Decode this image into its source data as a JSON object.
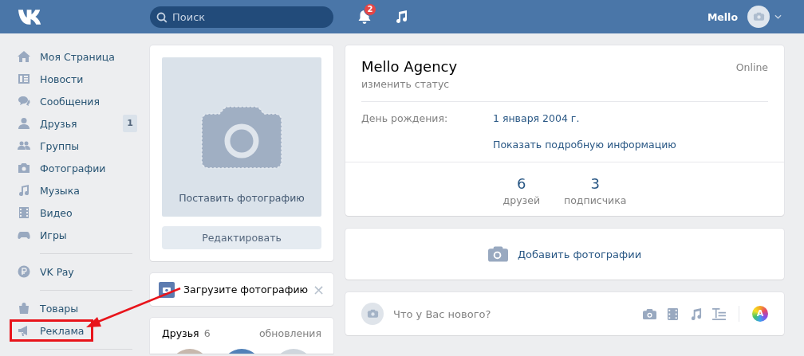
{
  "header": {
    "search": {
      "placeholder": "Поиск"
    },
    "notifications_badge": "2",
    "user_name": "Mello"
  },
  "sidebar": {
    "groups": [
      [
        {
          "label": "Моя Страница",
          "highlighted": false
        },
        {
          "label": "Новости",
          "highlighted": false
        },
        {
          "label": "Сообщения",
          "highlighted": false
        },
        {
          "label": "Друзья",
          "badge": "1",
          "highlighted": false
        },
        {
          "label": "Группы",
          "highlighted": false
        },
        {
          "label": "Фотографии",
          "highlighted": false
        },
        {
          "label": "Музыка",
          "highlighted": false
        },
        {
          "label": "Видео",
          "highlighted": false
        },
        {
          "label": "Игры",
          "highlighted": false
        }
      ],
      [
        {
          "label": "VK Pay",
          "highlighted": false
        }
      ],
      [
        {
          "label": "Товары",
          "highlighted": false
        },
        {
          "label": "Реклама",
          "highlighted": true
        }
      ]
    ]
  },
  "photo_card": {
    "caption": "Поставить фотографию",
    "edit_button": "Редактировать"
  },
  "notice": {
    "text": "Загрузите фотографию",
    "close": "×"
  },
  "friends_card": {
    "title": "Друзья",
    "count": "6",
    "updates_link": "обновления"
  },
  "profile": {
    "name": "Mello Agency",
    "status_link": "изменить статус",
    "online": "Online",
    "info": [
      {
        "label": "День рождения:",
        "value": "1 января 2004 г."
      }
    ],
    "more_link": "Показать подробную информацию",
    "counters": [
      {
        "value": "6",
        "label": "друзей"
      },
      {
        "value": "3",
        "label": "подписчика"
      }
    ]
  },
  "add_photos": "Добавить фотографии",
  "composer": {
    "placeholder": "Что у Вас нового?",
    "theme_letter": "A"
  }
}
